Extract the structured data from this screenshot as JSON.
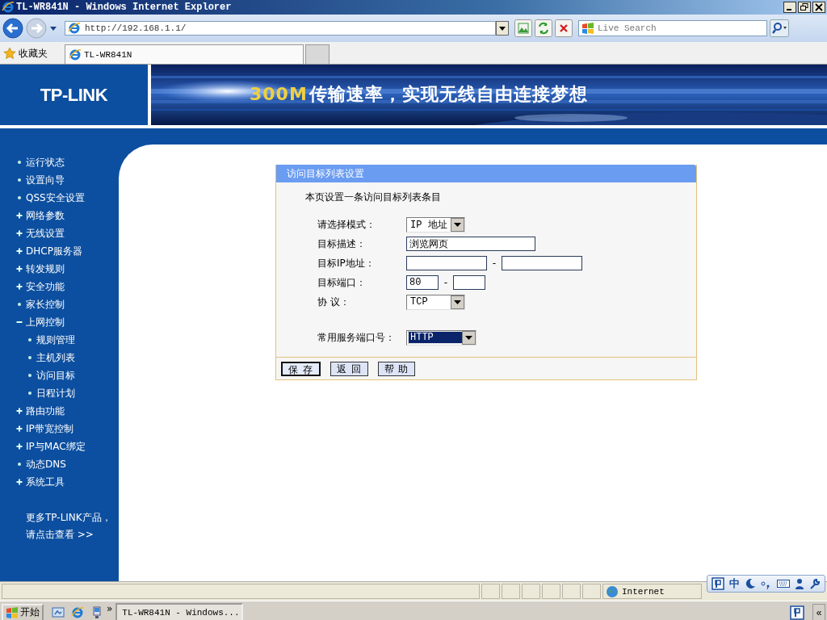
{
  "window": {
    "title": "TL-WR841N - Windows Internet Explorer"
  },
  "toolbar": {
    "address": "http://192.168.1.1/",
    "search_placeholder": "Live Search"
  },
  "favorites": {
    "label": "收藏夹",
    "tabs": [
      {
        "label": "TL-WR841N",
        "selected": true
      }
    ]
  },
  "banner": {
    "logo": "TP-LINK",
    "slogan_highlight": "300M",
    "slogan": "传输速率，实现无线自由连接梦想"
  },
  "sidebar": {
    "items": [
      {
        "label": "运行状态",
        "kind": "dot"
      },
      {
        "label": "设置向导",
        "kind": "dot"
      },
      {
        "label": "QSS安全设置",
        "kind": "dot"
      },
      {
        "label": "网络参数",
        "kind": "plus"
      },
      {
        "label": "无线设置",
        "kind": "plus"
      },
      {
        "label": "DHCP服务器",
        "kind": "plus"
      },
      {
        "label": "转发规则",
        "kind": "plus"
      },
      {
        "label": "安全功能",
        "kind": "plus"
      },
      {
        "label": "家长控制",
        "kind": "dot"
      },
      {
        "label": "上网控制",
        "kind": "minus",
        "children": [
          {
            "label": "规则管理",
            "kind": "dot"
          },
          {
            "label": "主机列表",
            "kind": "dot"
          },
          {
            "label": "访问目标",
            "kind": "dot"
          },
          {
            "label": "日程计划",
            "kind": "dot"
          }
        ]
      },
      {
        "label": "路由功能",
        "kind": "plus"
      },
      {
        "label": "IP带宽控制",
        "kind": "plus"
      },
      {
        "label": "IP与MAC绑定",
        "kind": "plus"
      },
      {
        "label": "动态DNS",
        "kind": "dot"
      },
      {
        "label": "系统工具",
        "kind": "plus"
      }
    ],
    "more_link": [
      "更多TP-LINK产品，",
      "请点击查看 >>"
    ]
  },
  "panel": {
    "title": "访问目标列表设置",
    "intro": "本页设置一条访问目标列表条目",
    "rows": [
      {
        "kind": "select",
        "label": "请选择模式：",
        "value": "IP 地址",
        "focused": false
      },
      {
        "kind": "text",
        "label": "目标描述：",
        "value": "浏览网页"
      },
      {
        "kind": "ip-range",
        "label": "目标IP地址：",
        "separator": "-"
      },
      {
        "kind": "port-range",
        "label": "目标端口：",
        "from": "80",
        "separator": "-"
      },
      {
        "kind": "select",
        "label": "协 议：",
        "value": "TCP",
        "focused": false
      },
      {
        "kind": "gap"
      },
      {
        "kind": "select",
        "label": "常用服务端口号：",
        "value": "HTTP",
        "focused": true
      }
    ],
    "buttons": [
      {
        "label": "保 存",
        "default": true
      },
      {
        "label": "返 回",
        "default": false
      },
      {
        "label": "帮 助",
        "default": false
      }
    ]
  },
  "status_bar": {
    "zone": "Internet",
    "ime": "中"
  },
  "taskbar": {
    "start": "开始",
    "more": "»",
    "tasks": [
      {
        "label": "TL-WR841N - Windows...",
        "selected": false
      }
    ],
    "collapse": "«"
  }
}
